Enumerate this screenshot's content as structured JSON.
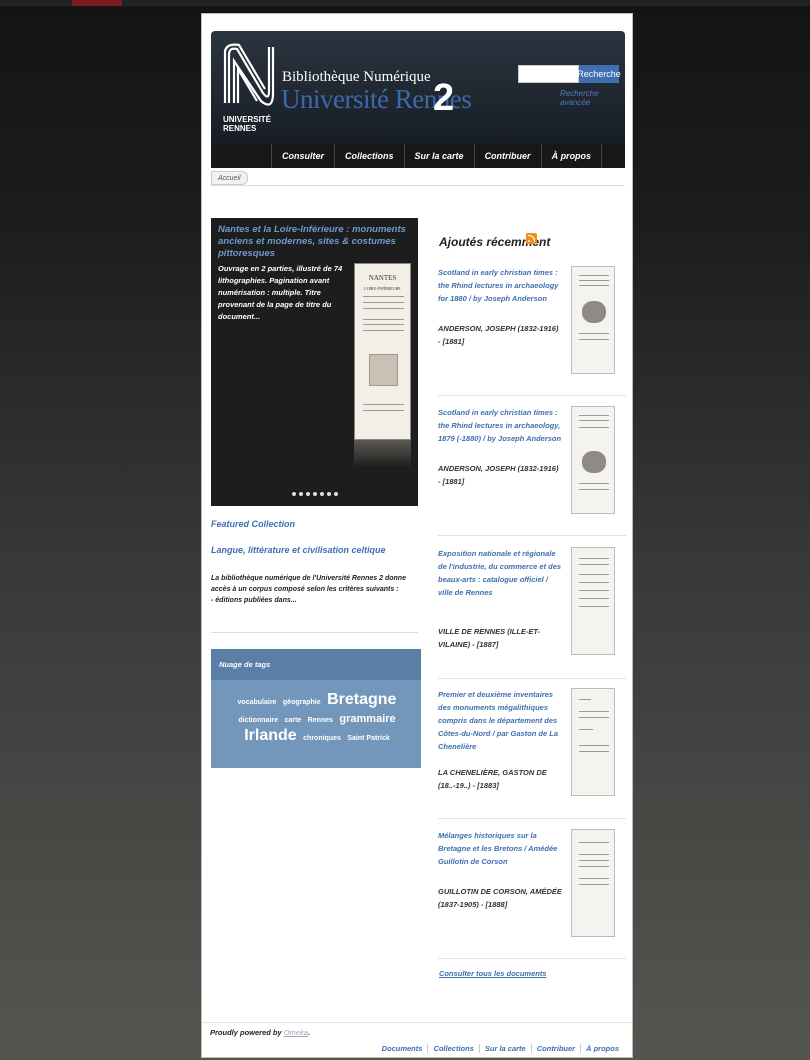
{
  "header": {
    "logo_text_line1": "UNIVERSITÉ",
    "logo_text_line2": "RENNES",
    "site_title_line1": "Bibliothèque Numérique",
    "site_title_line2": "Université Rennes",
    "site_title_number": "2",
    "search": {
      "value": "",
      "button_label": "Recherche",
      "advanced_label": "Recherche avancée"
    }
  },
  "nav": {
    "items": [
      "Consulter",
      "Collections",
      "Sur la carte",
      "Contribuer",
      "À propos"
    ]
  },
  "breadcrumb": {
    "home": "Accueil"
  },
  "featured_item": {
    "title": "Nantes et la Loire-Inférieure : monuments anciens et modernes, sites & costumes pittoresques",
    "description": "Ouvrage en 2 parties, illustré de 74 lithographies. Pagination avant numérisation : multiple. Titre provenant de la page de titre du document...",
    "thumb_text": "NANTES",
    "thumb_subtext": "LOIRE-INFÉRIEURE",
    "dots": 7
  },
  "featured_collection": {
    "label": "Featured Collection",
    "title": "Langue, littérature et civilisation celtique",
    "description": "La bibliothèque numérique de l'Université Rennes 2 donne accès à un corpus composé selon les critères suivants :\n- éditions publiées dans..."
  },
  "tag_cloud": {
    "heading": "Nuage de tags",
    "tags": [
      {
        "name": "vocabulaire",
        "size": "s"
      },
      {
        "name": "géographie",
        "size": "s"
      },
      {
        "name": "Bretagne",
        "size": "l"
      },
      {
        "name": "dictionnaire",
        "size": "s"
      },
      {
        "name": "carte",
        "size": "s"
      },
      {
        "name": "Rennes",
        "size": "s"
      },
      {
        "name": "grammaire",
        "size": "m"
      },
      {
        "name": "Irlande",
        "size": "l"
      },
      {
        "name": "chroniques",
        "size": "s"
      },
      {
        "name": "Saint Patrick",
        "size": "s"
      }
    ]
  },
  "recent": {
    "heading": "Ajoutés récemment",
    "items": [
      {
        "title": "Scotland in early christian times : the Rhind lectures in archaeology for 1880 / by Joseph Anderson",
        "author": "ANDERSON, JOSEPH (1832-1916) - [1881]"
      },
      {
        "title": "Scotland in early christian times : the Rhind lectures in archaeology, 1879 (-1880) / by Joseph Anderson",
        "author": "ANDERSON, JOSEPH (1832-1916) - [1881]"
      },
      {
        "title": "Exposition nationale et régionale de l'industrie, du commerce et des beaux-arts : catalogue officiel / ville de Rennes",
        "author": "VILLE DE RENNES (ILLE-ET-VILAINE) - [1887]"
      },
      {
        "title": "Premier et deuxième inventaires des monuments mégalithiques compris dans le département des Côtes-du-Nord / par Gaston de La Chenelière",
        "author": "LA CHENELIÈRE, GASTON DE (18..-19..) - [1883]"
      },
      {
        "title": "Mélanges historiques sur la Bretagne et les Bretons / Amédée Guillotin de Corson",
        "author": "GUILLOTIN DE CORSON, AMÉDÉE (1837-1905) - [1888]"
      }
    ],
    "all_link": "Consulter tous les documents"
  },
  "footer": {
    "powered_prefix": "Proudly powered by",
    "powered_link": "Omeka",
    "powered_suffix": ".",
    "nav": [
      "Documents",
      "Collections",
      "Sur la carte",
      "Contribuer",
      "À propos"
    ]
  }
}
